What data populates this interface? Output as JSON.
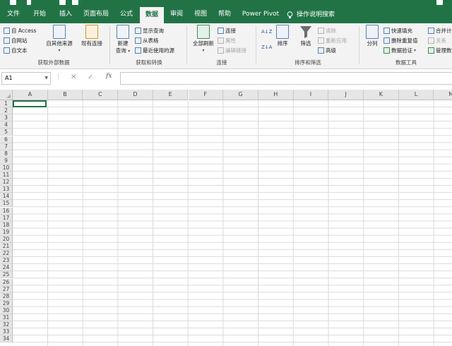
{
  "tabs": [
    {
      "label": "文件",
      "active": false
    },
    {
      "label": "开始",
      "active": false
    },
    {
      "label": "插入",
      "active": false
    },
    {
      "label": "页面布局",
      "active": false
    },
    {
      "label": "公式",
      "active": false
    },
    {
      "label": "数据",
      "active": true
    },
    {
      "label": "审阅",
      "active": false
    },
    {
      "label": "视图",
      "active": false
    },
    {
      "label": "帮助",
      "active": false
    },
    {
      "label": "Power Pivot",
      "active": false
    }
  ],
  "tell_me": "操作说明搜索",
  "ribbon": {
    "get_external": {
      "access": "自 Access",
      "web": "自网站",
      "text": "自文本",
      "other_sources": "自其他来源",
      "existing_connections": "现有连接",
      "group_label": "获取外部数据"
    },
    "get_transform": {
      "new_query": "新建",
      "new_query_2": "查询",
      "show_queries": "显示查询",
      "from_table": "从表格",
      "recent_sources": "最近使用的源",
      "group_label": "获取和转换"
    },
    "connections": {
      "refresh_all": "全部刷新",
      "connections": "连接",
      "properties": "属性",
      "edit_links": "编辑链接",
      "group_label": "连接"
    },
    "sort_filter": {
      "sort": "排序",
      "filter": "筛选",
      "clear": "清除",
      "reapply": "重新应用",
      "advanced": "高级",
      "group_label": "排序和筛选"
    },
    "data_tools": {
      "text_to_columns": "分列",
      "flash_fill": "快速填充",
      "remove_duplicates": "删除重复值",
      "data_validation": "数据验证",
      "consolidate": "合并计",
      "relationships": "关系",
      "manage_model": "管理数",
      "group_label": "数据工具"
    }
  },
  "formula_bar": {
    "name_box": "A1",
    "cancel": "✕",
    "enter": "✓",
    "fx": "fx",
    "value": ""
  },
  "columns": [
    "A",
    "B",
    "C",
    "D",
    "E",
    "F",
    "G",
    "H",
    "I",
    "J",
    "K",
    "L",
    "M"
  ],
  "rows": [
    "1",
    "2",
    "3",
    "4",
    "5",
    "6",
    "7",
    "8",
    "9",
    "10",
    "11",
    "12",
    "13",
    "14",
    "15",
    "16",
    "17",
    "18",
    "19",
    "20",
    "21",
    "22",
    "23",
    "24",
    "25",
    "26",
    "27",
    "28",
    "29",
    "30",
    "31",
    "32",
    "33",
    "34"
  ],
  "colors": {
    "accent": "#217346",
    "ribbon_bg": "#f3f3f3",
    "header_bg": "#e6e6e6",
    "gridline": "#dadada"
  }
}
